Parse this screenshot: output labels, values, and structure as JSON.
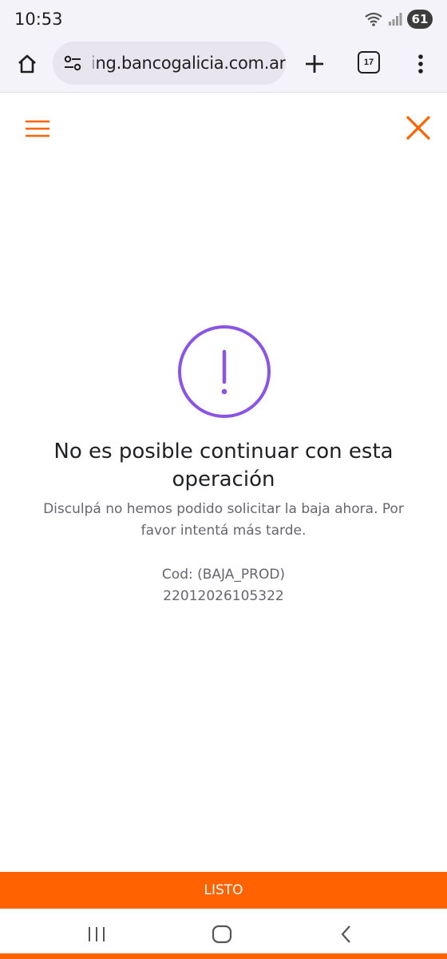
{
  "status_bar": {
    "time": "10:53",
    "battery": "61"
  },
  "browser": {
    "url_faded": "i",
    "url": "ng.bancogalicia.com.ar",
    "tab_count": "17"
  },
  "error": {
    "title": "No es posible continuar con esta operación",
    "message": "Disculpá no hemos podido solicitar la baja ahora. Por favor intentá más tarde.",
    "code_label": "Cod: (BAJA_PROD)",
    "code_value": "22012026105322"
  },
  "footer": {
    "button_label": "LISTO"
  },
  "colors": {
    "accent": "#ff6200",
    "alert_icon": "#8a55e6"
  }
}
